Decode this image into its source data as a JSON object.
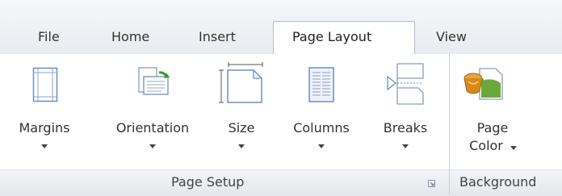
{
  "tabs": [
    {
      "label": "File"
    },
    {
      "label": "Home"
    },
    {
      "label": "Insert"
    },
    {
      "label": "Page Layout"
    },
    {
      "label": "View"
    }
  ],
  "active_tab": "Page Layout",
  "page_setup": {
    "group_label": "Page Setup",
    "buttons": [
      {
        "label": "Margins",
        "icon": "margins-icon"
      },
      {
        "label": "Orientation",
        "icon": "orientation-icon"
      },
      {
        "label": "Size",
        "icon": "size-icon"
      },
      {
        "label": "Columns",
        "icon": "columns-icon"
      },
      {
        "label": "Breaks",
        "icon": "breaks-icon"
      }
    ]
  },
  "background": {
    "group_label": "Background",
    "buttons": [
      {
        "label_line1": "Page",
        "label_line2": "Color",
        "icon": "paint-bucket-icon"
      }
    ]
  },
  "colors": {
    "accent_blue": "#6f8fc1",
    "paint_orange": "#d78a1c",
    "paint_green": "#6aa83b"
  }
}
